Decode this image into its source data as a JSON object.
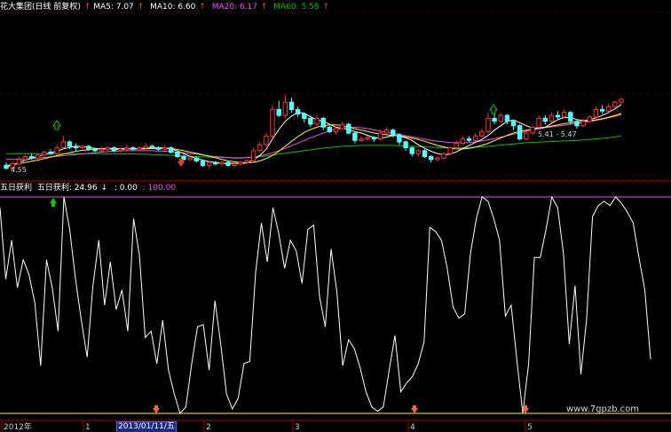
{
  "top_legend": {
    "title": "花大集团(日线 前复权)",
    "ma5": {
      "label": "MA5: 7.07",
      "color": "#ffffff"
    },
    "ma10": {
      "label": "MA10: 6.60",
      "color": "#ffff00"
    },
    "ma20": {
      "label": "MA20: 6.17",
      "color": "#ff40ff"
    },
    "ma60": {
      "label": "MA60: 5.58",
      "color": "#00c000"
    }
  },
  "bottom_legend": {
    "title": "五日获利",
    "value_label": "五日获利: 24.96",
    "zero_label": ": 0.00",
    "hundred_label": ": 100.00",
    "value_color": "#ffffff",
    "zero_color": "#ffff00",
    "hundred_color": "#ff40ff"
  },
  "price_annotations": {
    "low": "4.55",
    "level_range": "5.41 - 5.47"
  },
  "x_axis": {
    "ticks": [
      "2012年",
      "1",
      "2013/01/11/五",
      "2",
      "3",
      "4",
      "5"
    ],
    "highlighted": "2013/01/11/五"
  },
  "watermark": "www.7gpzb.com",
  "colors": {
    "up": "#ff3232",
    "down": "#54ffff",
    "ma5": "#ffffff",
    "ma10": "#ffff00",
    "ma20": "#ff40ff",
    "ma60": "#00c000",
    "grid": "#8b0000",
    "indicator": "#ffffff",
    "axis": "#b00000"
  },
  "chart_data": [
    {
      "type": "candlestick",
      "title": "花大集团(日线 前复权)",
      "candles": [
        [
          4.7,
          4.6,
          4.8,
          4.55
        ],
        [
          4.6,
          4.75,
          4.85,
          4.55
        ],
        [
          4.75,
          4.9,
          5.0,
          4.7
        ],
        [
          4.9,
          5.0,
          5.05,
          4.85
        ],
        [
          5.0,
          4.95,
          5.1,
          4.9
        ],
        [
          4.95,
          5.05,
          5.1,
          4.9
        ],
        [
          5.05,
          5.15,
          5.2,
          5.0
        ],
        [
          5.15,
          5.1,
          5.25,
          5.05
        ],
        [
          5.1,
          5.3,
          5.4,
          5.05
        ],
        [
          5.3,
          5.5,
          5.7,
          5.25
        ],
        [
          5.5,
          5.35,
          5.55,
          5.25
        ],
        [
          5.35,
          5.3,
          5.45,
          5.2
        ],
        [
          5.3,
          5.35,
          5.4,
          5.25
        ],
        [
          5.35,
          5.25,
          5.4,
          5.2
        ],
        [
          5.25,
          5.2,
          5.3,
          5.15
        ],
        [
          5.2,
          5.25,
          5.35,
          5.15
        ],
        [
          5.25,
          5.3,
          5.35,
          5.2
        ],
        [
          5.3,
          5.2,
          5.35,
          5.15
        ],
        [
          5.2,
          5.25,
          5.3,
          5.15
        ],
        [
          5.25,
          5.3,
          5.4,
          5.2
        ],
        [
          5.3,
          5.25,
          5.35,
          5.2
        ],
        [
          5.25,
          5.3,
          5.35,
          5.2
        ],
        [
          5.3,
          5.35,
          5.45,
          5.25
        ],
        [
          5.35,
          5.3,
          5.4,
          5.25
        ],
        [
          5.3,
          5.25,
          5.35,
          5.2
        ],
        [
          5.25,
          5.3,
          5.4,
          5.2
        ],
        [
          5.3,
          5.15,
          5.35,
          5.1
        ],
        [
          5.15,
          5.0,
          5.2,
          4.95
        ],
        [
          5.0,
          4.9,
          5.05,
          4.85
        ],
        [
          4.9,
          4.95,
          5.0,
          4.85
        ],
        [
          4.95,
          4.85,
          5.0,
          4.8
        ],
        [
          4.85,
          4.7,
          4.9,
          4.65
        ],
        [
          4.7,
          4.8,
          4.85,
          4.6
        ],
        [
          4.8,
          4.75,
          4.85,
          4.7
        ],
        [
          4.75,
          4.8,
          4.85,
          4.7
        ],
        [
          4.8,
          4.7,
          4.85,
          4.65
        ],
        [
          4.7,
          4.75,
          4.8,
          4.65
        ],
        [
          4.75,
          4.8,
          4.85,
          4.7
        ],
        [
          4.8,
          4.85,
          4.9,
          4.75
        ],
        [
          4.85,
          5.2,
          5.3,
          4.8
        ],
        [
          5.2,
          5.4,
          5.5,
          5.15
        ],
        [
          5.4,
          5.7,
          5.8,
          5.35
        ],
        [
          5.7,
          6.6,
          6.75,
          5.6
        ],
        [
          6.6,
          6.4,
          6.9,
          6.35
        ],
        [
          6.4,
          6.85,
          7.1,
          6.3
        ],
        [
          6.85,
          6.6,
          7.0,
          6.5
        ],
        [
          6.6,
          6.45,
          6.7,
          6.35
        ],
        [
          6.45,
          6.3,
          6.5,
          6.15
        ],
        [
          6.3,
          6.1,
          6.4,
          6.0
        ],
        [
          6.1,
          6.3,
          6.4,
          6.0
        ],
        [
          6.3,
          6.0,
          6.35,
          5.9
        ],
        [
          6.0,
          5.85,
          6.05,
          5.8
        ],
        [
          5.85,
          5.95,
          6.0,
          5.75
        ],
        [
          5.95,
          6.1,
          6.15,
          5.9
        ],
        [
          6.1,
          5.8,
          6.15,
          5.75
        ],
        [
          5.8,
          5.55,
          5.85,
          5.45
        ],
        [
          5.55,
          5.6,
          5.7,
          5.5
        ],
        [
          5.6,
          5.65,
          5.7,
          5.55
        ],
        [
          5.65,
          5.6,
          5.7,
          5.5
        ],
        [
          5.6,
          5.8,
          5.9,
          5.55
        ],
        [
          5.8,
          5.9,
          6.0,
          5.75
        ],
        [
          5.9,
          5.75,
          5.95,
          5.65
        ],
        [
          5.75,
          5.5,
          5.8,
          5.4
        ],
        [
          5.5,
          5.3,
          5.55,
          5.2
        ],
        [
          5.3,
          5.1,
          5.35,
          5.0
        ],
        [
          5.1,
          5.2,
          5.25,
          5.0
        ],
        [
          5.2,
          5.0,
          5.25,
          4.95
        ],
        [
          5.0,
          4.9,
          5.05,
          4.8
        ],
        [
          4.9,
          4.95,
          5.0,
          4.85
        ],
        [
          4.95,
          5.1,
          5.15,
          4.9
        ],
        [
          5.1,
          5.3,
          5.35,
          5.05
        ],
        [
          5.3,
          5.45,
          5.55,
          5.25
        ],
        [
          5.45,
          5.6,
          5.7,
          5.4
        ],
        [
          5.6,
          5.55,
          5.7,
          5.5
        ],
        [
          5.55,
          5.7,
          5.8,
          5.5
        ],
        [
          5.7,
          5.85,
          5.95,
          5.65
        ],
        [
          5.85,
          6.3,
          6.5,
          5.8
        ],
        [
          6.3,
          6.2,
          6.45,
          6.1
        ],
        [
          6.2,
          6.4,
          6.5,
          6.15
        ],
        [
          6.4,
          6.2,
          6.45,
          6.1
        ],
        [
          6.2,
          6.05,
          6.25,
          5.9
        ],
        [
          6.05,
          5.6,
          6.1,
          5.55
        ],
        [
          5.6,
          5.8,
          5.85,
          5.55
        ],
        [
          5.8,
          6.0,
          6.05,
          5.75
        ],
        [
          6.0,
          6.3,
          6.4,
          5.95
        ],
        [
          6.3,
          6.2,
          6.4,
          6.1
        ],
        [
          6.2,
          6.4,
          6.5,
          6.15
        ],
        [
          6.4,
          6.35,
          6.55,
          6.25
        ],
        [
          6.35,
          6.5,
          6.6,
          6.3
        ],
        [
          6.5,
          6.2,
          6.55,
          6.1
        ],
        [
          6.2,
          6.05,
          6.25,
          5.95
        ],
        [
          6.05,
          6.2,
          6.3,
          6.0
        ],
        [
          6.2,
          6.35,
          6.4,
          6.15
        ],
        [
          6.35,
          6.6,
          6.7,
          6.3
        ],
        [
          6.6,
          6.55,
          6.75,
          6.45
        ],
        [
          6.55,
          6.7,
          6.8,
          6.5
        ],
        [
          6.7,
          6.85,
          6.9,
          6.65
        ],
        [
          6.85,
          6.95,
          7.0,
          6.8
        ]
      ],
      "ma5": [
        4.65,
        4.72,
        4.8,
        4.88,
        4.94,
        5.01,
        5.07,
        5.12,
        5.18,
        5.26,
        5.31,
        5.35,
        5.34,
        5.31,
        5.28,
        5.26,
        5.26,
        5.25,
        5.24,
        5.26,
        5.26,
        5.27,
        5.29,
        5.3,
        5.3,
        5.3,
        5.26,
        5.19,
        5.1,
        5.01,
        4.94,
        4.88,
        4.83,
        4.8,
        4.77,
        4.76,
        4.77,
        4.77,
        4.78,
        4.89,
        5.04,
        5.25,
        5.6,
        5.92,
        6.2,
        6.38,
        6.5,
        6.48,
        6.35,
        6.25,
        6.2,
        6.1,
        6.0,
        5.96,
        5.93,
        5.85,
        5.8,
        5.72,
        5.65,
        5.63,
        5.66,
        5.72,
        5.7,
        5.64,
        5.55,
        5.4,
        5.28,
        5.18,
        5.1,
        5.06,
        5.08,
        5.16,
        5.27,
        5.38,
        5.48,
        5.58,
        5.72,
        5.9,
        6.05,
        6.2,
        6.25,
        6.15,
        6.05,
        5.97,
        5.97,
        6.0,
        6.13,
        6.26,
        6.33,
        6.32,
        6.26,
        6.22,
        6.25,
        6.32,
        6.4,
        6.5,
        6.63,
        6.77
      ],
      "ma10": [
        4.7,
        4.72,
        4.76,
        4.8,
        4.84,
        4.88,
        4.93,
        4.98,
        5.03,
        5.08,
        5.13,
        5.18,
        5.21,
        5.23,
        5.25,
        5.27,
        5.28,
        5.28,
        5.27,
        5.27,
        5.26,
        5.26,
        5.26,
        5.27,
        5.28,
        5.28,
        5.27,
        5.24,
        5.2,
        5.15,
        5.11,
        5.06,
        5.01,
        4.96,
        4.9,
        4.85,
        4.82,
        4.8,
        4.79,
        4.8,
        4.85,
        4.93,
        5.04,
        5.18,
        5.35,
        5.52,
        5.68,
        5.82,
        5.92,
        6.0,
        6.05,
        6.08,
        6.08,
        6.05,
        6.0,
        5.95,
        5.9,
        5.85,
        5.8,
        5.77,
        5.74,
        5.72,
        5.7,
        5.67,
        5.63,
        5.58,
        5.52,
        5.45,
        5.38,
        5.33,
        5.28,
        5.26,
        5.26,
        5.28,
        5.32,
        5.38,
        5.45,
        5.54,
        5.63,
        5.72,
        5.8,
        5.86,
        5.9,
        5.94,
        5.97,
        6.0,
        6.04,
        6.08,
        6.12,
        6.15,
        6.18,
        6.2,
        6.22,
        6.25,
        6.29,
        6.34,
        6.4,
        6.47
      ],
      "ma20": [
        4.9,
        4.9,
        4.91,
        4.92,
        4.93,
        4.95,
        4.97,
        4.99,
        5.01,
        5.03,
        5.05,
        5.07,
        5.09,
        5.11,
        5.13,
        5.15,
        5.17,
        5.18,
        5.19,
        5.2,
        5.2,
        5.2,
        5.2,
        5.2,
        5.19,
        5.18,
        5.17,
        5.15,
        5.13,
        5.1,
        5.08,
        5.05,
        5.02,
        5.0,
        4.98,
        4.96,
        4.95,
        4.95,
        4.96,
        4.98,
        5.02,
        5.07,
        5.13,
        5.2,
        5.28,
        5.37,
        5.46,
        5.55,
        5.64,
        5.72,
        5.8,
        5.87,
        5.93,
        5.97,
        6.0,
        6.0,
        5.98,
        5.95,
        5.91,
        5.87,
        5.83,
        5.79,
        5.75,
        5.71,
        5.67,
        5.63,
        5.59,
        5.55,
        5.52,
        5.5,
        5.48,
        5.47,
        5.47,
        5.48,
        5.5,
        5.53,
        5.57,
        5.61,
        5.66,
        5.71,
        5.76,
        5.81,
        5.86,
        5.9,
        5.94,
        5.98,
        6.01,
        6.04,
        6.07,
        6.1,
        6.13,
        6.16,
        6.19,
        6.23,
        6.27,
        6.32,
        6.37,
        6.43
      ],
      "ma60": [
        5.1,
        5.1,
        5.1,
        5.1,
        5.1,
        5.1,
        5.1,
        5.1,
        5.1,
        5.1,
        5.1,
        5.1,
        5.1,
        5.1,
        5.1,
        5.1,
        5.1,
        5.1,
        5.09,
        5.09,
        5.09,
        5.08,
        5.08,
        5.07,
        5.06,
        5.05,
        5.04,
        5.03,
        5.02,
        5.01,
        5.0,
        4.99,
        4.98,
        4.97,
        4.96,
        4.96,
        4.96,
        4.96,
        4.97,
        4.98,
        5.0,
        5.02,
        5.05,
        5.08,
        5.11,
        5.14,
        5.17,
        5.2,
        5.23,
        5.26,
        5.29,
        5.31,
        5.33,
        5.35,
        5.36,
        5.37,
        5.38,
        5.38,
        5.38,
        5.38,
        5.38,
        5.38,
        5.37,
        5.36,
        5.35,
        5.34,
        5.33,
        5.32,
        5.31,
        5.3,
        5.3,
        5.3,
        5.3,
        5.31,
        5.32,
        5.33,
        5.35,
        5.37,
        5.39,
        5.41,
        5.43,
        5.45,
        5.47,
        5.48,
        5.49,
        5.5,
        5.51,
        5.52,
        5.53,
        5.54,
        5.55,
        5.56,
        5.58,
        5.6,
        5.62,
        5.64,
        5.67,
        5.7
      ],
      "ylim": [
        4.35,
        7.25
      ]
    },
    {
      "type": "line",
      "title": "五日获利",
      "name": "五日获利",
      "ylim": [
        0,
        100
      ],
      "reference_lines": [
        0,
        100
      ],
      "values": [
        95,
        62,
        80,
        58,
        71,
        64,
        51,
        22,
        71,
        58,
        38,
        100,
        85,
        62,
        43,
        26,
        59,
        80,
        50,
        70,
        48,
        57,
        38,
        90,
        73,
        35,
        38,
        23,
        43,
        20,
        9,
        0,
        3,
        23,
        40,
        41,
        20,
        52,
        32,
        9,
        2,
        7,
        23,
        24,
        65,
        88,
        70,
        95,
        83,
        67,
        80,
        75,
        60,
        85,
        87,
        54,
        40,
        76,
        56,
        22,
        34,
        30,
        21,
        10,
        3,
        1,
        3,
        20,
        36,
        10,
        14,
        17,
        23,
        33,
        86,
        84,
        80,
        67,
        49,
        44,
        46,
        74,
        90,
        100,
        98,
        90,
        80,
        45,
        50,
        24,
        0,
        23,
        72,
        72,
        85,
        100,
        95,
        74,
        32,
        59,
        18,
        44,
        91,
        96,
        98,
        96,
        100,
        97,
        93,
        88,
        72,
        57,
        25
      ]
    }
  ]
}
